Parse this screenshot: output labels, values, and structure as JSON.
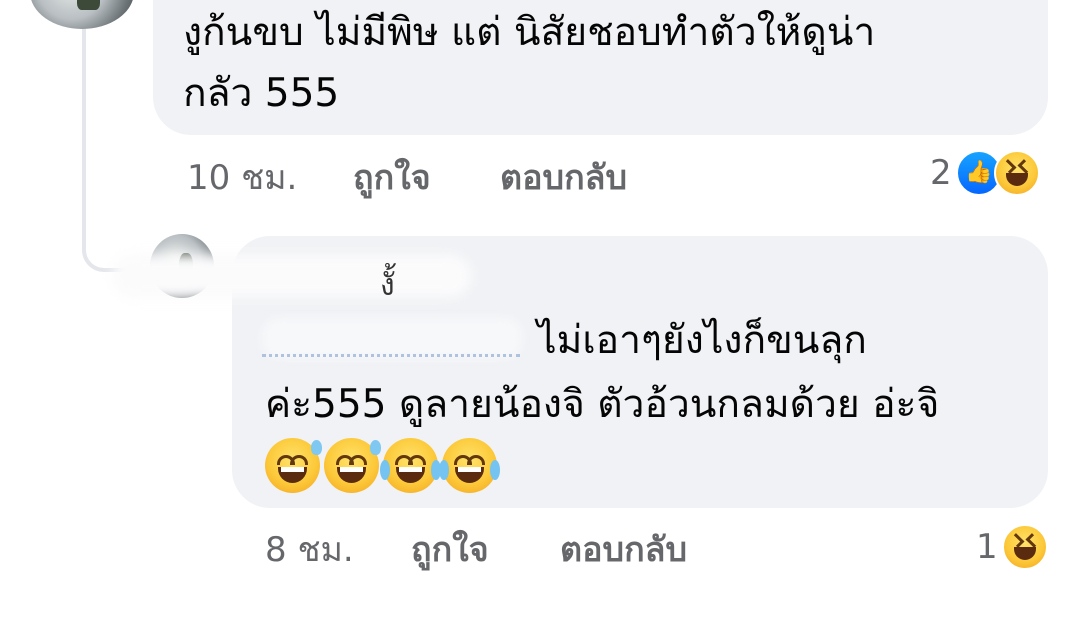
{
  "comment": {
    "text_line1": "งูก้นขบ ไม่มีพิษ แต่ นิสัยชอบทำตัวให้ดูน่า",
    "text_line2": "กลัว 555",
    "time": "10 ชม.",
    "like_label": "ถูกใจ",
    "reply_label": "ตอบกลับ",
    "reaction_count": "2",
    "reactions": [
      "like-icon",
      "haha-icon"
    ]
  },
  "reply": {
    "text_line1": "ไม่เอาๆยังไงก็ขนลุก",
    "text_line2": "ค่ะ555 ดูลายน้องจิ ตัวอ้วนกลมด้วย อ่ะจิ",
    "emojis": [
      "grinning-sweat-icon",
      "grinning-sweat-icon",
      "tears-of-joy-icon",
      "tears-of-joy-icon"
    ],
    "time": "8 ชม.",
    "like_label": "ถูกใจ",
    "reply_label": "ตอบกลับ",
    "reaction_count": "1",
    "reactions": [
      "haha-icon"
    ]
  },
  "colors": {
    "bubble": "#f0f2f5",
    "meta_text": "#65676b",
    "like_blue": "#0566ff",
    "emoji_yellow": "#fcc93a"
  }
}
